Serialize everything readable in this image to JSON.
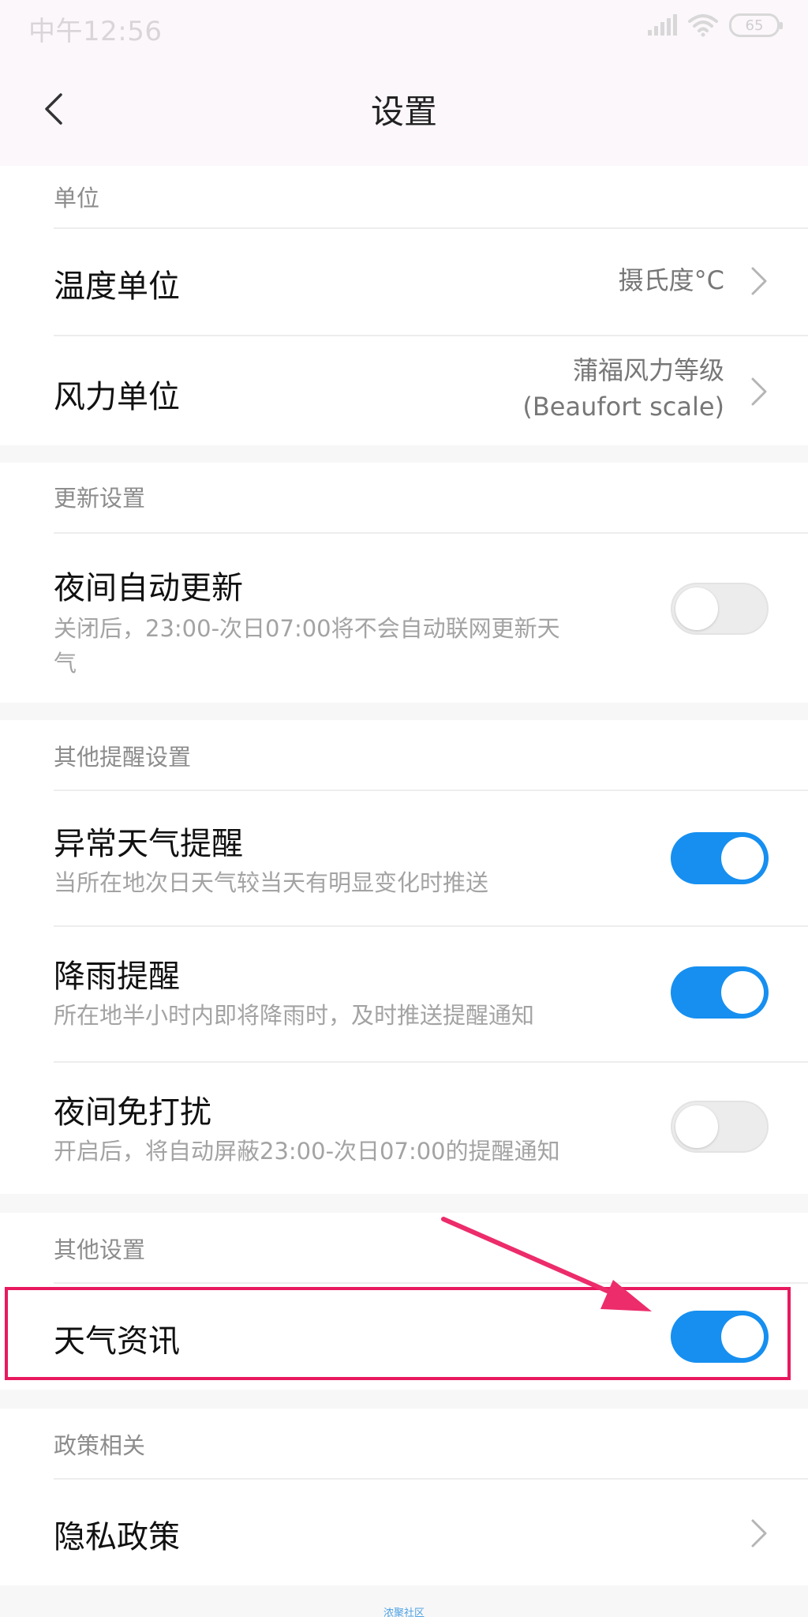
{
  "status_bar": {
    "time": "中午12:56",
    "battery": "65"
  },
  "header": {
    "title": "设置"
  },
  "sections": {
    "units": {
      "title": "单位",
      "temperature": {
        "label": "温度单位",
        "value": "摄氏度°C"
      },
      "wind": {
        "label": "风力单位",
        "value_line1": "蒲福风力等级",
        "value_line2": "(Beaufort scale)"
      }
    },
    "update": {
      "title": "更新设置",
      "night_update": {
        "label": "夜间自动更新",
        "description_line1": "关闭后，23:00-次日07:00将不会自动联网更新天",
        "description_line2": "气",
        "enabled": false
      }
    },
    "reminders": {
      "title": "其他提醒设置",
      "abnormal_weather": {
        "label": "异常天气提醒",
        "description": "当所在地次日天气较当天有明显变化时推送",
        "enabled": true
      },
      "rain": {
        "label": "降雨提醒",
        "description": "所在地半小时内即将降雨时，及时推送提醒通知",
        "enabled": true
      },
      "night_dnd": {
        "label": "夜间免打扰",
        "description": "开启后，将自动屏蔽23:00-次日07:00的提醒通知",
        "enabled": false
      }
    },
    "other": {
      "title": "其他设置",
      "weather_news": {
        "label": "天气资讯",
        "enabled": true
      }
    },
    "policy": {
      "title": "政策相关",
      "privacy": {
        "label": "隐私政策"
      }
    }
  },
  "watermark": "浓聚社区",
  "colors": {
    "toggle_on": "#168ff0",
    "toggle_off": "#ececec",
    "highlight": "#e8195f",
    "header_bg": "#fcf7fb"
  },
  "icons": {
    "back": "chevron-left-icon",
    "row_arrow": "chevron-right-icon",
    "signal": "signal-icon",
    "wifi": "wifi-icon",
    "battery": "battery-icon"
  }
}
